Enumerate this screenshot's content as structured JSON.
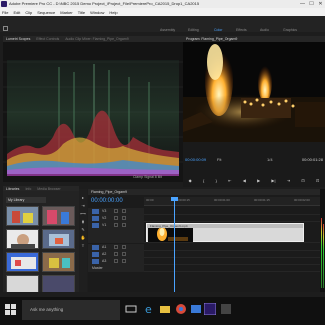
{
  "window": {
    "title": "Adobe Premiere Pro CC - D:\\NBC 2015 Demo Project_\\Project_File\\PremierePro_CA2015_Drop1_CA2015",
    "minimize": "—",
    "maximize": "☐",
    "close": "✕"
  },
  "menu": [
    "File",
    "Edit",
    "Clip",
    "Sequence",
    "Marker",
    "Title",
    "Window",
    "Help"
  ],
  "workspaces": {
    "home": "⌂",
    "items": [
      "Assembly",
      "Editing",
      "Color",
      "Effects",
      "Audio",
      "Graphics"
    ],
    "active_index": 2
  },
  "source_panel": {
    "tabs": [
      "Lumetri Scopes",
      "Effect Controls",
      "Audio Clip Mixer: Flaming_Pipe_Orgam9"
    ],
    "active_tab": 0,
    "bottom_label": "Clamp Signal  8 Bit"
  },
  "program_panel": {
    "tab": "Program: Flaming_Pipe_Orgam9",
    "timecode_left": "00:00:00:09",
    "timecode_right": "00:00:01:28",
    "fit": "Fit",
    "quality": "1/4",
    "transport": [
      "◆",
      "{",
      "}",
      "⇤",
      "◀",
      "▶",
      "▶|",
      "⇥",
      "⊡",
      "⊡"
    ]
  },
  "libraries_panel": {
    "tabs": [
      "Libraries",
      "Info",
      "Media Browser"
    ],
    "active_tab": 0,
    "selected_library": "My Library"
  },
  "tools": [
    "▸",
    "⇥",
    "⟷",
    "⧫",
    "✎",
    "✋",
    "T"
  ],
  "timeline": {
    "tab": "Flaming_Pipe_Orgam9",
    "timecode": "00:00:00:00",
    "ruler": [
      "00:00",
      "00:00:00:15",
      "00:00:01:00",
      "00:00:01:15",
      "00:00:02:00"
    ],
    "video_tracks": [
      "V3",
      "V2",
      "V1"
    ],
    "audio_tracks": [
      "A1",
      "A2",
      "A3",
      "Master"
    ],
    "clip_label": "Flaming_Pipe_Orgam9.mp4"
  },
  "taskbar": {
    "search_placeholder": "Ask me anything",
    "icons": [
      "task-view-icon",
      "edge-icon",
      "explorer-icon",
      "chrome-icon",
      "photos-icon",
      "premiere-icon",
      "app-icon"
    ]
  },
  "colors": {
    "accent": "#4aa3ff",
    "panel_bg": "#1d1d1d",
    "premiere": "#2a1a66",
    "clip": "#d9d9d9"
  }
}
